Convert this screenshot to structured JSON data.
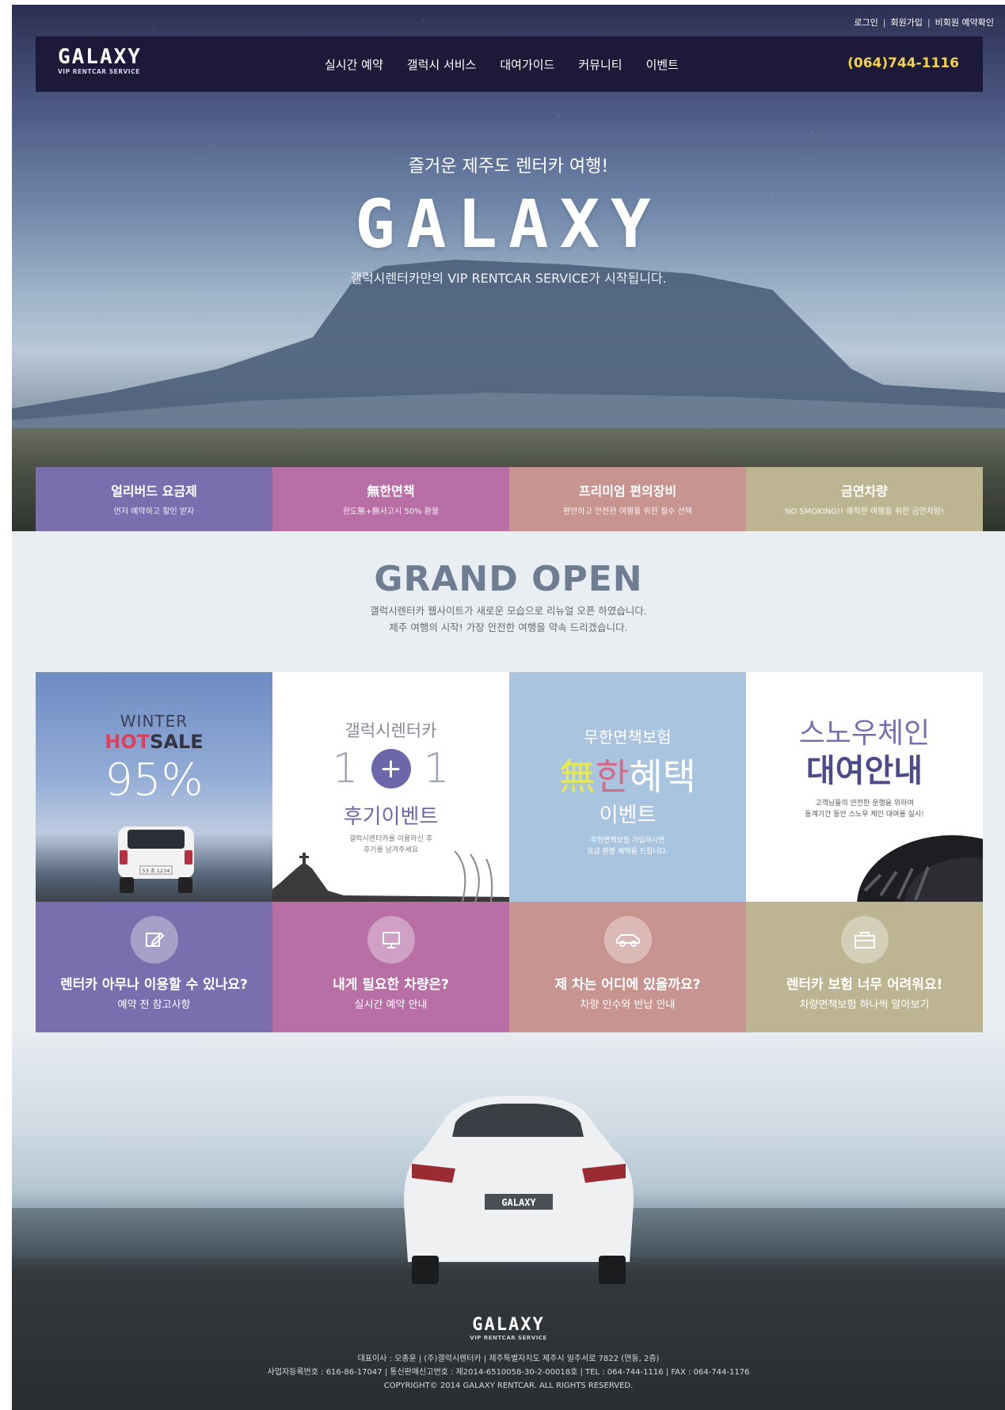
{
  "top_links": [
    "로그인",
    "회원가입",
    "비회원 예약확인"
  ],
  "logo": {
    "name": "GALAXY",
    "tagline": "VIP RENTCAR SERVICE"
  },
  "nav": [
    "실시간 예약",
    "갤럭시 서비스",
    "대여가이드",
    "커뮤니티",
    "이벤트"
  ],
  "phone": "(064)744-1116",
  "hero": {
    "subtitle": "즐거운 제주도 렌터카 여행!",
    "title": "GALAXY",
    "description": "갤럭시렌터카만의 VIP RENTCAR SERVICE가 시작됩니다."
  },
  "features": [
    {
      "title": "얼리버드 요금제",
      "subtitle": "먼저 예약하고 할인 받자",
      "color": "#7b6eae"
    },
    {
      "title": "無한면책",
      "subtitle": "한도無+無사고시 50% 환불",
      "color": "#b86fa6"
    },
    {
      "title": "프리미엄 편의장비",
      "subtitle": "편안하고 안전한 여행을 위한 필수 선택",
      "color": "#c79490"
    },
    {
      "title": "금연차량",
      "subtitle": "NO SMOKING!! 쾌적한 여행을 위한 금연차량!",
      "color": "#bdb592"
    }
  ],
  "grand_open": {
    "title": "GRAND OPEN",
    "lines": [
      "갤럭시렌터카 웹사이트가 새로운 모습으로 리뉴얼 오픈 하였습니다.",
      "제주 여행의 시작! 가장 안전한 여행을 약속 드리겠습니다."
    ]
  },
  "banners": {
    "winter": {
      "line1": "WINTER",
      "hot": "HOT",
      "sale": "SALE",
      "percent": "95%",
      "plate": "53 조 1234"
    },
    "event11": {
      "brand": "갤럭시렌터카",
      "left": "1",
      "plus": "+",
      "right": "1",
      "title": "후기이벤트",
      "desc1": "갤럭시렌터카를 이용하신 후",
      "desc2": "후기를 남겨주세요"
    },
    "insurance": {
      "top": "무한면책보험",
      "mu": "無",
      "han": "한",
      "rest": "혜택",
      "event": "이벤트",
      "desc1": "무한면책보험 가입하시면",
      "desc2": "요금 환불 혜택을 드립니다."
    },
    "snow": {
      "title1": "스노우체인",
      "title2": "대여안내",
      "desc1": "고객님들의 안전한 운행을 위하여",
      "desc2": "동계기간 동안 스노우 체인 대여를 실시!"
    }
  },
  "cards": [
    {
      "title": "렌터카 아무나 이용할 수 있나요?",
      "subtitle": "예약 전 참고사항",
      "icon": "edit-icon",
      "color": "#7b6eae"
    },
    {
      "title": "내게 필요한 차량은?",
      "subtitle": "실시간 예약 안내",
      "icon": "monitor-icon",
      "color": "#b86fa6"
    },
    {
      "title": "제 차는 어디에 있을까요?",
      "subtitle": "차량 인수와 반납 안내",
      "icon": "car-icon",
      "color": "#c79490"
    },
    {
      "title": "렌터카 보험 너무 어려워요!",
      "subtitle": "차량면책보험 하나씩 알아보기",
      "icon": "briefcase-icon",
      "color": "#bdb592"
    }
  ],
  "footer": {
    "logo": "GALAXY",
    "tagline": "VIP RENTCAR SERVICE",
    "plate": "GALAXY",
    "line1": "대표이사 : 오종윤 | (주)갤럭시렌터카 | 제주특별자치도 제주시 일주서로 7822 (연동, 2층)",
    "line2": "사업자등록번호 : 616-86-17047 | 통신판매신고번호 : 제2014-6510058-30-2-00018호 | TEL : 064-744-1116 | FAX : 064-744-1176",
    "line3": "COPYRIGHT© 2014 GALAXY RENTCAR. ALL RIGHTS RESERVED."
  }
}
